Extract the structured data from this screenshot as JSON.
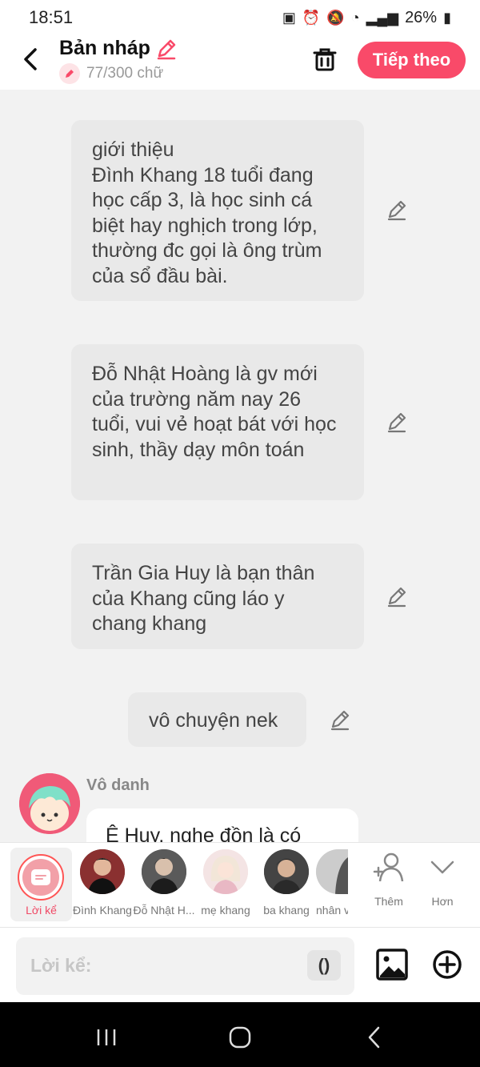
{
  "status": {
    "time": "18:51",
    "battery": "26%"
  },
  "header": {
    "title": "Bản nháp",
    "word_count": "77/300 chữ",
    "next_label": "Tiếp theo"
  },
  "messages": [
    "giới thiệu\nĐình Khang 18 tuổi đang học cấp 3, là học sinh cá biệt hay nghịch trong lớp, thường đc gọi là ông trùm của sổ đầu bài.",
    "Đỗ Nhật Hoàng là gv mới của trường năm nay 26 tuổi, vui vẻ hoạt bát với học sinh, thầy dạy môn toán",
    "Trần Gia Huy là bạn thân của Khang cũng láo y chang khang",
    "vô chuyện nek"
  ],
  "last_message": {
    "author": "Vô danh",
    "text": "Ê Huy, nghe đồn là có"
  },
  "characters": {
    "narrator": "Lời kể",
    "list": [
      "Đình Khang",
      "Đỗ Nhật H...",
      "mẹ khang",
      "ba khang",
      "nhân v"
    ],
    "add_label": "Thêm",
    "more_label": "Hơn"
  },
  "input": {
    "placeholder": "Lời kể:",
    "paren_label": "()"
  },
  "colors": {
    "accent": "#f94a69",
    "bubble": "#e9e9e9",
    "background": "#f2f2f2"
  },
  "icons": [
    "back-icon",
    "pencil-icon",
    "trash-icon",
    "edit-icon",
    "add-character-icon",
    "chevron-down-icon",
    "image-icon",
    "plus-circle-icon"
  ]
}
